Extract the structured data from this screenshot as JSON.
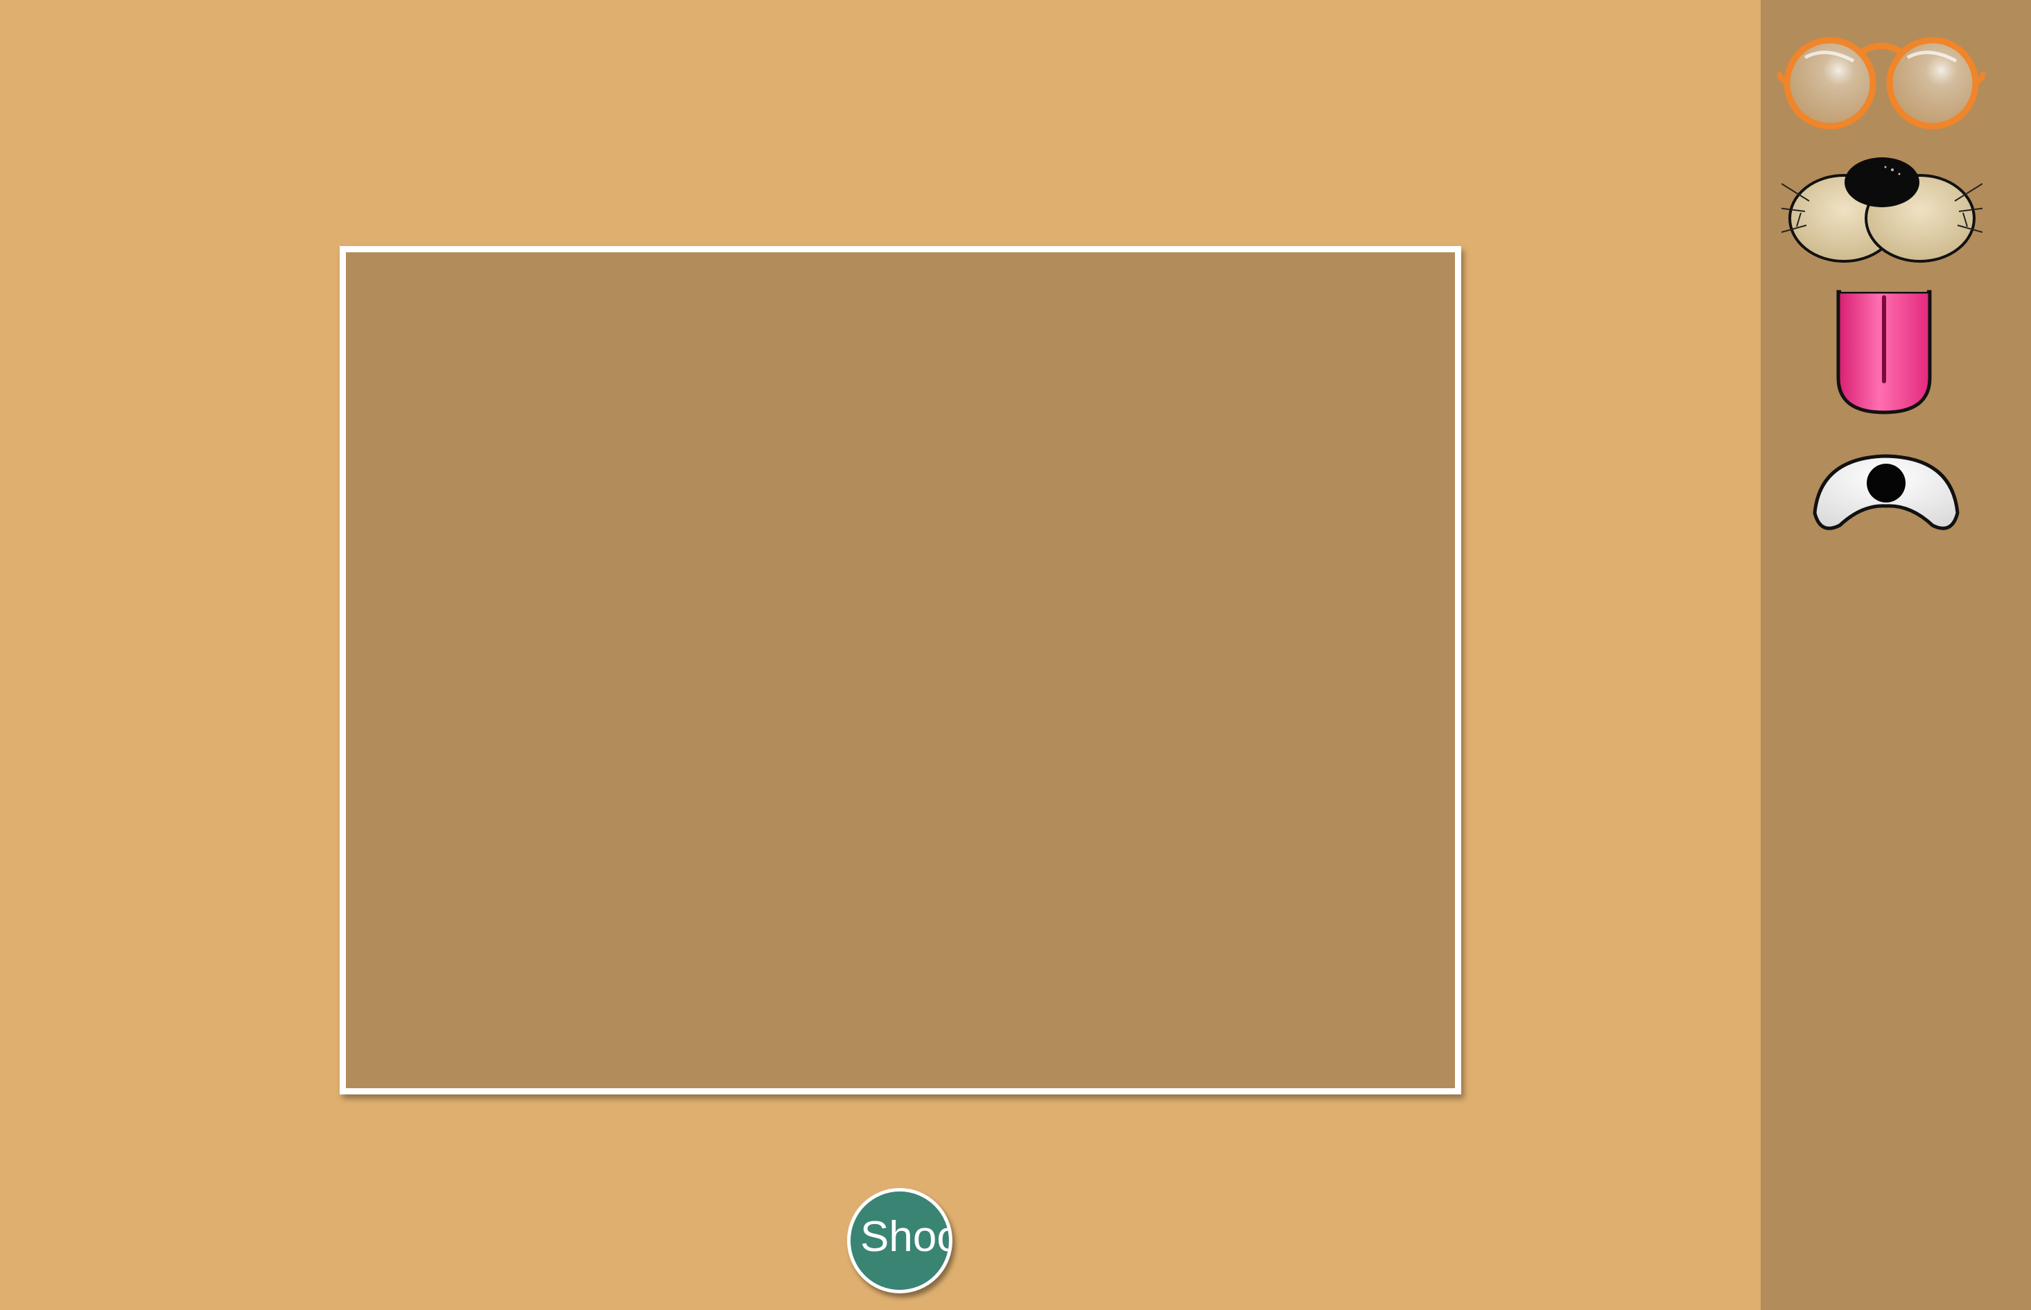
{
  "controls": {
    "shoot_label": "Shoo"
  },
  "sidebar": {
    "stickers": [
      {
        "name": "glasses",
        "icon": "orange-round-glasses-icon",
        "color": "#f0852a"
      },
      {
        "name": "muzzle",
        "icon": "dog-muzzle-nose-icon",
        "color": "#d9c8a0"
      },
      {
        "name": "tongue",
        "icon": "pink-tongue-icon",
        "color": "#ee3d8f"
      },
      {
        "name": "eye",
        "icon": "cartoon-eye-icon",
        "color": "#ffffff"
      }
    ]
  },
  "colors": {
    "background": "#dfaf6f",
    "panel": "#b38c5b",
    "frame_border": "#ffffff",
    "button": "#3a8474"
  }
}
